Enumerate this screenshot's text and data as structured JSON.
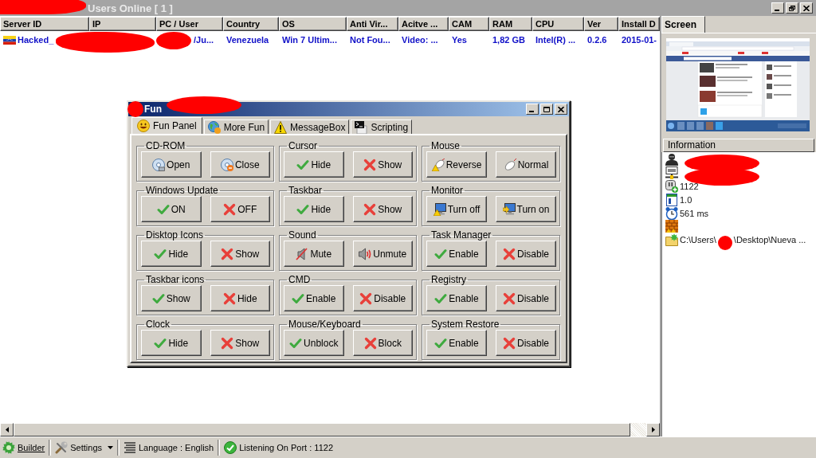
{
  "window": {
    "title": "Users Online [ 1 ]",
    "redacted": true
  },
  "table": {
    "columns": [
      "Server ID",
      "IP",
      "PC / User",
      "Country",
      "OS",
      "Anti Vir...",
      "Acitve ...",
      "CAM",
      "RAM",
      "CPU",
      "Ver",
      "Install D"
    ],
    "rows": [
      {
        "cells": [
          {
            "kind": "flag",
            "text": "Hacked_"
          },
          {
            "kind": "redacted"
          },
          {
            "kind": "redacted",
            "text": "/Ju..."
          },
          {
            "kind": "text",
            "text": "Venezuela"
          },
          {
            "kind": "text",
            "text": "Win 7 Ultim..."
          },
          {
            "kind": "text",
            "text": "Not Fou..."
          },
          {
            "kind": "text",
            "text": "Video: ..."
          },
          {
            "kind": "text",
            "text": "Yes"
          },
          {
            "kind": "text",
            "text": "1,82 GB"
          },
          {
            "kind": "text",
            "text": "Intel(R) ..."
          },
          {
            "kind": "text",
            "text": "0.2.6"
          },
          {
            "kind": "text",
            "text": "2015-01-"
          }
        ]
      }
    ]
  },
  "screen": {
    "tab": {
      "label": "Screen",
      "selected": true
    }
  },
  "information": {
    "title": "Information",
    "items": [
      {
        "kind": "user",
        "redacted": true
      },
      {
        "kind": "network",
        "redacted": true
      },
      {
        "kind": "port",
        "text": "1122"
      },
      {
        "kind": "version",
        "text": "1.0"
      },
      {
        "kind": "ping",
        "text": "561 ms"
      },
      {
        "kind": "firewall"
      },
      {
        "kind": "folder",
        "text": "C:\\Users\\",
        "redacted": true,
        "text_after": "\\Desktop\\Nueva ..."
      }
    ]
  },
  "fun_window": {
    "title": "Fun",
    "redacted": true,
    "tabs": [
      {
        "label": "Fun Panel",
        "kind": "smiley",
        "selected": true
      },
      {
        "label": "More Fun",
        "kind": "globe",
        "selected": false
      },
      {
        "label": "MessageBox",
        "kind": "warning",
        "selected": false
      },
      {
        "label": "Scripting",
        "kind": "terminal",
        "selected": false
      }
    ],
    "groups": [
      {
        "title": "CD-ROM",
        "buttons": [
          {
            "label": "Open",
            "kind": "cd"
          },
          {
            "label": "Close",
            "kind": "cd-eject"
          }
        ]
      },
      {
        "title": "Cursor",
        "buttons": [
          {
            "label": "Hide",
            "kind": "check"
          },
          {
            "label": "Show",
            "kind": "cross"
          }
        ]
      },
      {
        "title": "Mouse",
        "buttons": [
          {
            "label": "Reverse",
            "kind": "mouse-warning"
          },
          {
            "label": "Normal",
            "kind": "mouse"
          }
        ]
      },
      {
        "title": "Windows Update",
        "buttons": [
          {
            "label": "ON",
            "kind": "check"
          },
          {
            "label": "OFF",
            "kind": "cross"
          }
        ]
      },
      {
        "title": "Taskbar",
        "buttons": [
          {
            "label": "Hide",
            "kind": "check"
          },
          {
            "label": "Show",
            "kind": "cross"
          }
        ]
      },
      {
        "title": "Monitor",
        "buttons": [
          {
            "label": "Turn off",
            "kind": "monitor-warning"
          },
          {
            "label": "Turn on",
            "kind": "monitor-on"
          }
        ]
      },
      {
        "title": "Disktop Icons",
        "buttons": [
          {
            "label": "Hide",
            "kind": "check"
          },
          {
            "label": "Show",
            "kind": "cross"
          }
        ]
      },
      {
        "title": "Sound",
        "buttons": [
          {
            "label": "Mute",
            "kind": "speaker-mute"
          },
          {
            "label": "Unmute",
            "kind": "speaker"
          }
        ]
      },
      {
        "title": "Task Manager",
        "buttons": [
          {
            "label": "Enable",
            "kind": "check"
          },
          {
            "label": "Disable",
            "kind": "cross"
          }
        ]
      },
      {
        "title": "Taskbar icons",
        "buttons": [
          {
            "label": "Show",
            "kind": "check"
          },
          {
            "label": "Hide",
            "kind": "cross"
          }
        ]
      },
      {
        "title": "CMD",
        "buttons": [
          {
            "label": "Enable",
            "kind": "check"
          },
          {
            "label": "Disable",
            "kind": "cross"
          }
        ]
      },
      {
        "title": "Registry",
        "buttons": [
          {
            "label": "Enable",
            "kind": "check"
          },
          {
            "label": "Disable",
            "kind": "cross"
          }
        ]
      },
      {
        "title": "Clock",
        "buttons": [
          {
            "label": "Hide",
            "kind": "check"
          },
          {
            "label": "Show",
            "kind": "cross"
          }
        ]
      },
      {
        "title": "Mouse/Keyboard",
        "buttons": [
          {
            "label": "Unblock",
            "kind": "check"
          },
          {
            "label": "Block",
            "kind": "cross"
          }
        ]
      },
      {
        "title": "System Restore",
        "buttons": [
          {
            "label": "Enable",
            "kind": "check"
          },
          {
            "label": "Disable",
            "kind": "cross"
          }
        ]
      }
    ]
  },
  "status_bar": {
    "items": [
      {
        "kind": "builder",
        "label": "Builder"
      },
      {
        "kind": "settings",
        "label": "Settings"
      },
      {
        "kind": "language",
        "label": "Language : English"
      },
      {
        "kind": "listening",
        "label": "Listening On Port : 1122"
      }
    ]
  }
}
